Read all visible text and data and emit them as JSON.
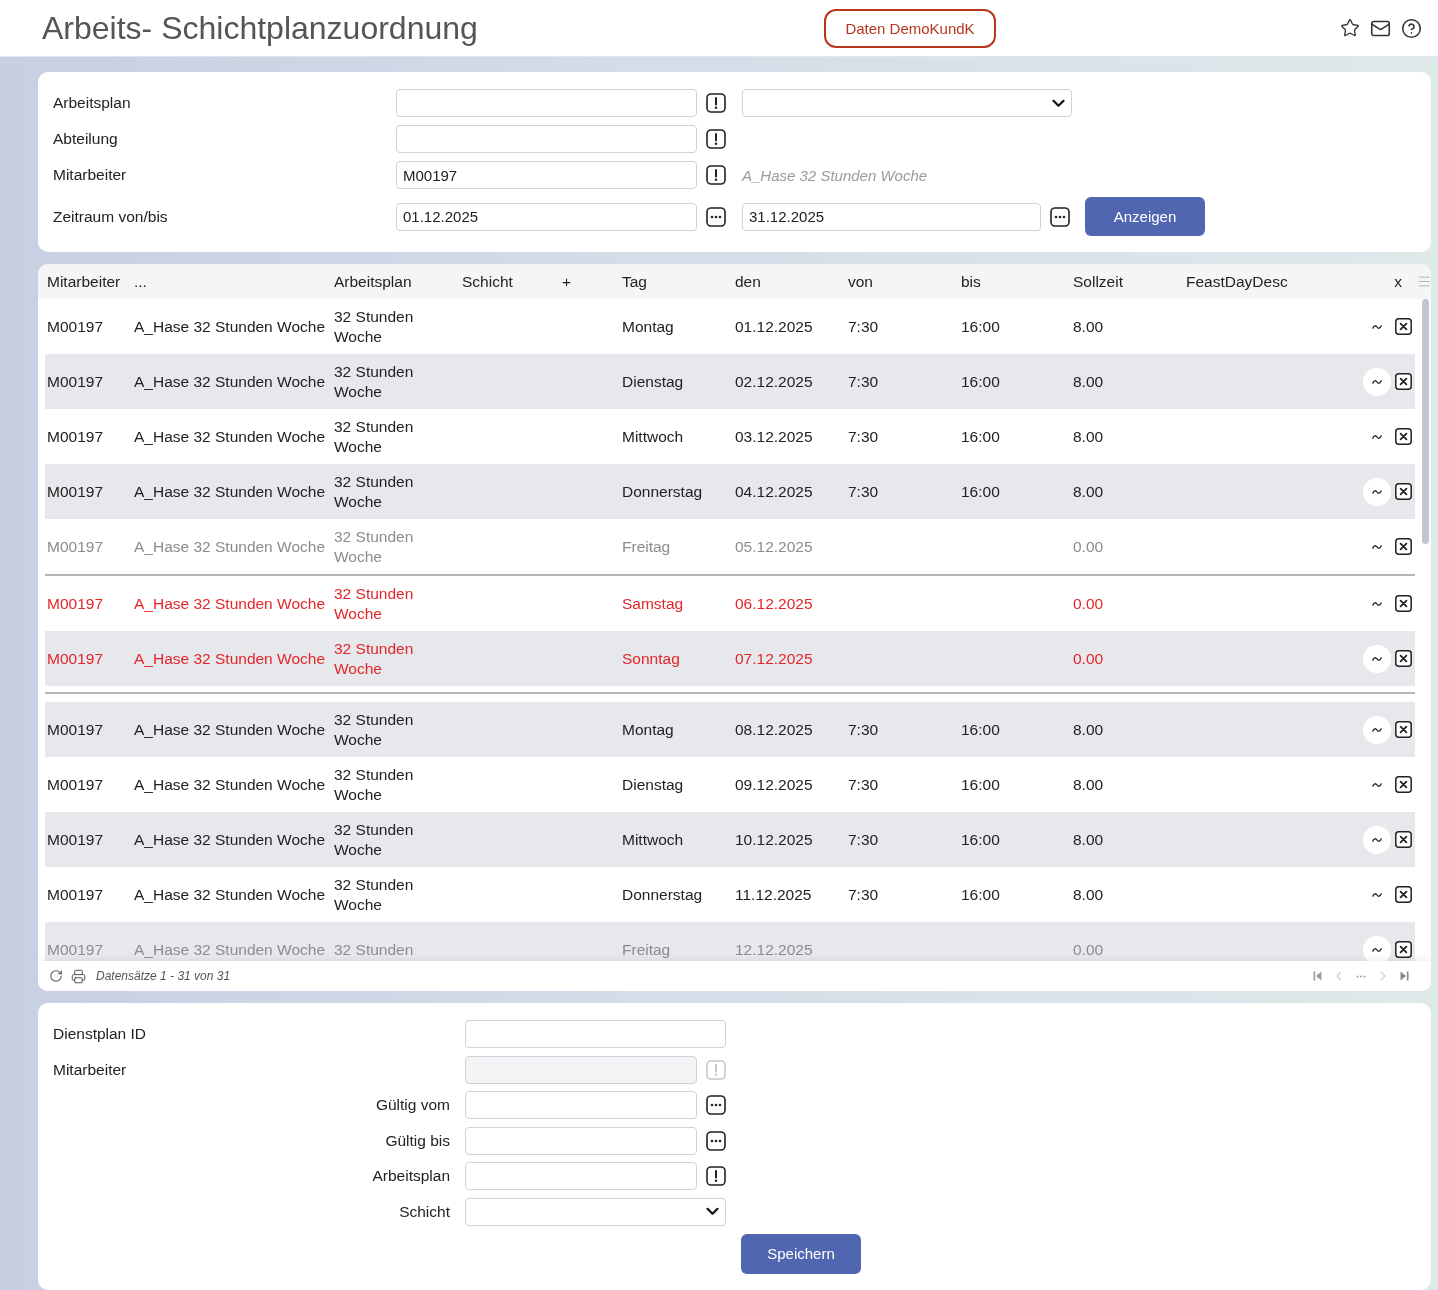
{
  "header": {
    "title": "Arbeits- Schichtplanzuordnung",
    "badge": "Daten DemoKundK"
  },
  "filter": {
    "rows": [
      {
        "label": "Arbeitsplan",
        "field": {
          "kind": "lookup"
        },
        "extra": {
          "kind": "select"
        }
      },
      {
        "label": "Abteilung",
        "field": {
          "kind": "lookup"
        }
      },
      {
        "label": "Mitarbeiter",
        "field": {
          "kind": "lookup",
          "value": "M00197"
        },
        "extra": {
          "kind": "description",
          "text": "A_Hase 32 Stunden Woche"
        }
      },
      {
        "label": "Zeitraum von/bis",
        "field": {
          "kind": "date",
          "value": "01.12.2025"
        },
        "extra": {
          "kind": "date",
          "value": "31.12.2025"
        },
        "button": "Anzeigen"
      }
    ]
  },
  "table": {
    "columns": [
      "Mitarbeiter",
      "...",
      "Arbeitsplan",
      "Schicht",
      "+",
      "Tag",
      "den",
      "von",
      "bis",
      "Sollzeit",
      "FeastDayDesc",
      "x"
    ],
    "rows": [
      {
        "kind": "workday",
        "shaded": false,
        "divider_below": false,
        "employee": "M00197",
        "name": "A_Hase 32 Stunden Woche",
        "plan": "32 Stunden Woche",
        "day": "Montag",
        "date": "01.12.2025",
        "from": "7:30",
        "to": "16:00",
        "hours": "8.00"
      },
      {
        "kind": "workday",
        "shaded": true,
        "divider_below": false,
        "employee": "M00197",
        "name": "A_Hase 32 Stunden Woche",
        "plan": "32 Stunden Woche",
        "day": "Dienstag",
        "date": "02.12.2025",
        "from": "7:30",
        "to": "16:00",
        "hours": "8.00"
      },
      {
        "kind": "workday",
        "shaded": false,
        "divider_below": false,
        "employee": "M00197",
        "name": "A_Hase 32 Stunden Woche",
        "plan": "32 Stunden Woche",
        "day": "Mittwoch",
        "date": "03.12.2025",
        "from": "7:30",
        "to": "16:00",
        "hours": "8.00"
      },
      {
        "kind": "workday",
        "shaded": true,
        "divider_below": false,
        "employee": "M00197",
        "name": "A_Hase 32 Stunden Woche",
        "plan": "32 Stunden Woche",
        "day": "Donnerstag",
        "date": "04.12.2025",
        "from": "7:30",
        "to": "16:00",
        "hours": "8.00"
      },
      {
        "kind": "off",
        "shaded": false,
        "divider_below": true,
        "employee": "M00197",
        "name": "A_Hase 32 Stunden Woche",
        "plan": "32 Stunden Woche",
        "day": "Freitag",
        "date": "05.12.2025",
        "hours": "0.00"
      },
      {
        "kind": "weekend",
        "shaded": false,
        "divider_below": false,
        "employee": "M00197",
        "name": "A_Hase 32 Stunden Woche",
        "plan": "32 Stunden Woche",
        "day": "Samstag",
        "date": "06.12.2025",
        "hours": "0.00"
      },
      {
        "kind": "weekend",
        "shaded": true,
        "divider_below": true,
        "employee": "M00197",
        "name": "A_Hase 32 Stunden Woche",
        "plan": "32 Stunden Woche",
        "day": "Sonntag",
        "date": "07.12.2025",
        "hours": "0.00"
      },
      {
        "kind": "workday",
        "shaded": true,
        "divider_below": false,
        "employee": "M00197",
        "name": "A_Hase 32 Stunden Woche",
        "plan": "32 Stunden Woche",
        "day": "Montag",
        "date": "08.12.2025",
        "from": "7:30",
        "to": "16:00",
        "hours": "8.00"
      },
      {
        "kind": "workday",
        "shaded": false,
        "divider_below": false,
        "employee": "M00197",
        "name": "A_Hase 32 Stunden Woche",
        "plan": "32 Stunden Woche",
        "day": "Dienstag",
        "date": "09.12.2025",
        "from": "7:30",
        "to": "16:00",
        "hours": "8.00"
      },
      {
        "kind": "workday",
        "shaded": true,
        "divider_below": false,
        "employee": "M00197",
        "name": "A_Hase 32 Stunden Woche",
        "plan": "32 Stunden Woche",
        "day": "Mittwoch",
        "date": "10.12.2025",
        "from": "7:30",
        "to": "16:00",
        "hours": "8.00"
      },
      {
        "kind": "workday",
        "shaded": false,
        "divider_below": false,
        "employee": "M00197",
        "name": "A_Hase 32 Stunden Woche",
        "plan": "32 Stunden Woche",
        "day": "Donnerstag",
        "date": "11.12.2025",
        "from": "7:30",
        "to": "16:00",
        "hours": "8.00"
      },
      {
        "kind": "off",
        "shaded": true,
        "divider_below": false,
        "employee": "M00197",
        "name": "A_Hase 32 Stunden Woche",
        "plan": "32 Stunden",
        "day": "Freitag",
        "date": "12.12.2025",
        "hours": "0.00"
      }
    ],
    "footer": "Datensätze 1 - 31 von 31"
  },
  "bottom_form": {
    "header_fields": [
      {
        "label": "Dienstplan ID",
        "kind": "text",
        "disabled": false
      },
      {
        "label": "Mitarbeiter",
        "kind": "lookup",
        "disabled": true
      }
    ],
    "fields": [
      {
        "label": "Gültig vom",
        "kind": "date",
        "disabled": false
      },
      {
        "label": "Gültig bis",
        "kind": "date",
        "disabled": false
      },
      {
        "label": "Arbeitsplan",
        "kind": "lookup",
        "disabled": false
      },
      {
        "label": "Schicht",
        "kind": "select",
        "disabled": false
      }
    ],
    "button": "Speichern"
  }
}
